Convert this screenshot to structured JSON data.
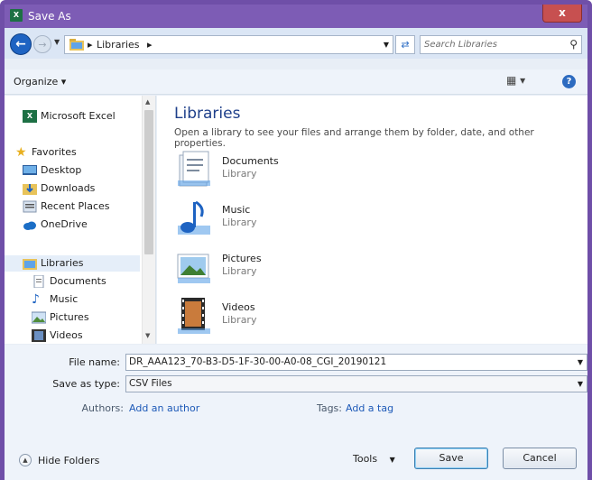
{
  "window": {
    "title": "Save As",
    "close_label": "x"
  },
  "address": {
    "path": [
      "Libraries"
    ],
    "search_placeholder": "Search Libraries"
  },
  "toolbar": {
    "organize_label": "Organize ▾"
  },
  "nav": {
    "items": [
      {
        "label": "Microsoft Excel"
      },
      {
        "label": "Favorites"
      },
      {
        "label": "Desktop"
      },
      {
        "label": "Downloads"
      },
      {
        "label": "Recent Places"
      },
      {
        "label": "OneDrive"
      },
      {
        "label": "Libraries"
      },
      {
        "label": "Documents"
      },
      {
        "label": "Music"
      },
      {
        "label": "Pictures"
      },
      {
        "label": "Videos"
      }
    ]
  },
  "content": {
    "title": "Libraries",
    "subtitle": "Open a library to see your files and arrange them by folder, date, and other properties.",
    "libraries": [
      {
        "name": "Documents",
        "type": "Library"
      },
      {
        "name": "Music",
        "type": "Library"
      },
      {
        "name": "Pictures",
        "type": "Library"
      },
      {
        "name": "Videos",
        "type": "Library"
      }
    ]
  },
  "form": {
    "file_name_label": "File name:",
    "file_name_value": "DR_AAA123_70-B3-D5-1F-30-00-A0-08_CGI_20190121",
    "save_type_label": "Save as type:",
    "save_type_value": "CSV Files",
    "authors_label": "Authors:",
    "authors_value": "Add an author",
    "tags_label": "Tags:",
    "tags_value": "Add a tag"
  },
  "footer": {
    "hide_folders_label": "Hide Folders",
    "tools_label": "Tools",
    "save_label": "Save",
    "cancel_label": "Cancel"
  }
}
